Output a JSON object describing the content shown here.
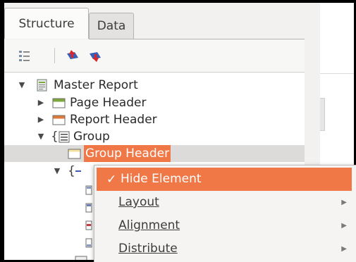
{
  "tabs": [
    {
      "label": "Structure"
    },
    {
      "label": "Data"
    }
  ],
  "toolbar": {
    "buttons": [
      {
        "icon": "list-view-icon"
      },
      {
        "icon": "move-up-icon"
      },
      {
        "icon": "move-down-icon"
      }
    ]
  },
  "tree": {
    "master_report": "Master Report",
    "page_header": "Page Header",
    "report_header": "Report Header",
    "group": "Group",
    "group_header": "Group Header"
  },
  "context_menu": {
    "hide_element": "Hide Element",
    "layout": "Layout",
    "alignment": "Alignment",
    "distribute": "Distribute"
  },
  "colors": {
    "accent": "#f07746",
    "page_header_icon": "#7ea83a",
    "report_header_icon": "#e07a3a"
  }
}
